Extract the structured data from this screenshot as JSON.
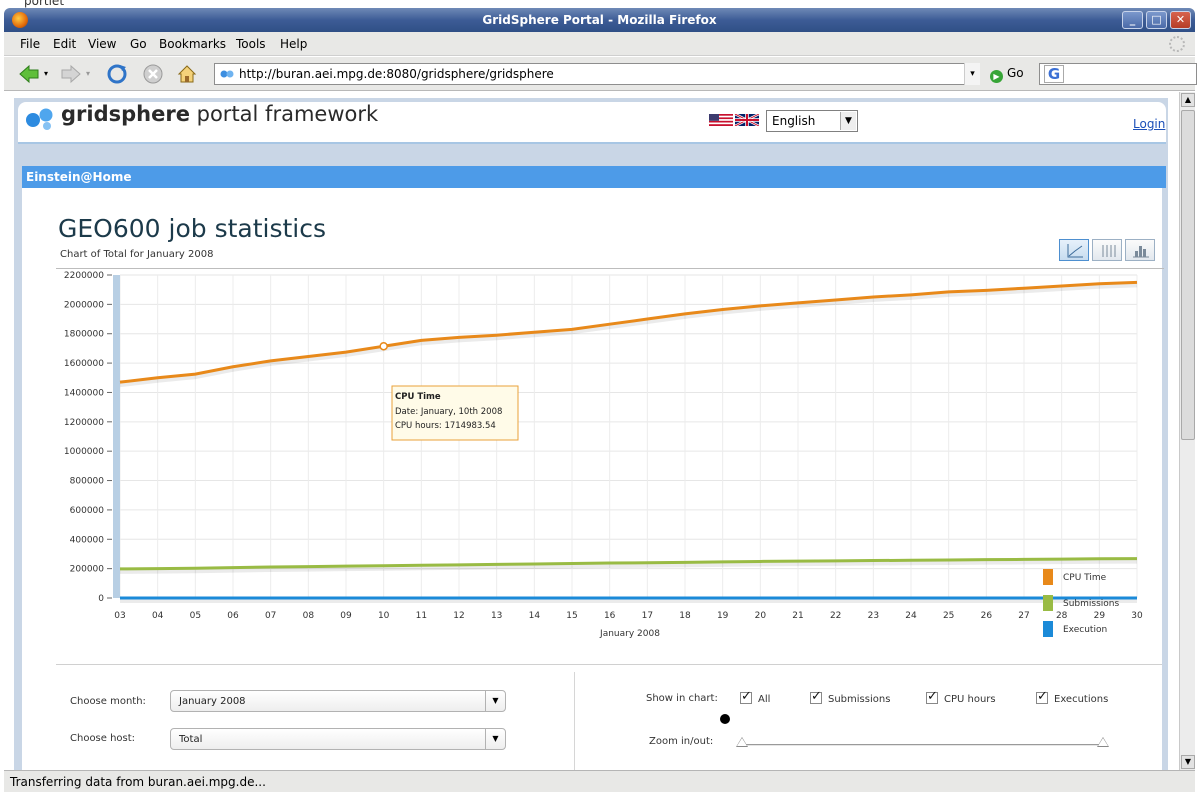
{
  "top_fragment": "portlet",
  "window": {
    "title": "GridSphere Portal - Mozilla Firefox",
    "controls": [
      "minimize",
      "maximize",
      "close"
    ]
  },
  "menubar": {
    "items": [
      {
        "label": "File"
      },
      {
        "label": "Edit"
      },
      {
        "label": "View"
      },
      {
        "label": "Go"
      },
      {
        "label": "Bookmarks"
      },
      {
        "label": "Tools"
      },
      {
        "label": "Help"
      }
    ]
  },
  "navbar": {
    "url": "http://buran.aei.mpg.de:8080/gridsphere/gridsphere",
    "go_label": "Go",
    "search_engine_letter": "G"
  },
  "portal": {
    "logo_bold": "gridsphere",
    "logo_rest": " portal framework",
    "language": "English",
    "login_label": "Login",
    "portlet_title": "Einstein@Home"
  },
  "page": {
    "title": "GEO600 job statistics",
    "subtitle": "Chart of Total for January 2008",
    "view_buttons": [
      "line-chart-icon",
      "table-icon",
      "bar-chart-icon"
    ]
  },
  "chart_data": {
    "type": "line",
    "xlabel": "January 2008",
    "ylabel": "",
    "x": [
      "03",
      "04",
      "05",
      "06",
      "07",
      "08",
      "09",
      "10",
      "11",
      "12",
      "13",
      "14",
      "15",
      "16",
      "17",
      "18",
      "19",
      "20",
      "21",
      "22",
      "23",
      "24",
      "25",
      "26",
      "27",
      "28",
      "29",
      "30"
    ],
    "ylim": [
      0,
      2200000
    ],
    "yticks": [
      "2200000",
      "2000000",
      "1800000",
      "1600000",
      "1400000",
      "1200000",
      "1000000",
      "800000",
      "600000",
      "400000",
      "200000",
      "0"
    ],
    "grid": true,
    "legend_position": "bottom-right",
    "series": [
      {
        "name": "CPU Time",
        "color": "#e8891a",
        "values": [
          1470000,
          1500000,
          1525000,
          1575000,
          1615000,
          1645000,
          1675000,
          1714984,
          1755000,
          1775000,
          1790000,
          1810000,
          1830000,
          1865000,
          1900000,
          1935000,
          1965000,
          1990000,
          2010000,
          2030000,
          2050000,
          2065000,
          2085000,
          2095000,
          2110000,
          2125000,
          2140000,
          2150000
        ]
      },
      {
        "name": "Submissions",
        "color": "#99bb44",
        "values": [
          198000,
          200000,
          203000,
          207000,
          211000,
          214000,
          217000,
          220000,
          223000,
          226000,
          229000,
          232000,
          235000,
          238000,
          240000,
          243000,
          246000,
          249000,
          251000,
          253000,
          255000,
          257000,
          259000,
          261000,
          263000,
          265000,
          267000,
          268000
        ]
      },
      {
        "name": "Execution",
        "color": "#1b8ad8",
        "values": [
          0,
          0,
          0,
          0,
          0,
          0,
          0,
          0,
          0,
          0,
          0,
          0,
          0,
          0,
          0,
          0,
          0,
          0,
          0,
          0,
          0,
          0,
          0,
          0,
          0,
          0,
          0,
          0
        ]
      }
    ],
    "tooltip": {
      "series": "CPU Time",
      "title": "CPU Time",
      "date_line": "Date: January, 10th 2008",
      "value_line": "CPU hours: 1714983.54",
      "x": "10",
      "y": 1714984
    }
  },
  "controls": {
    "choose_month_label": "Choose month:",
    "month_value": "January 2008",
    "choose_host_label": "Choose host:",
    "host_value": "Total",
    "show_in_chart_label": "Show in chart:",
    "checkboxes": [
      {
        "label": "All",
        "checked": true
      },
      {
        "label": "Submissions",
        "checked": true
      },
      {
        "label": "CPU hours",
        "checked": true
      },
      {
        "label": "Executions",
        "checked": true
      }
    ],
    "zoom_label": "Zoom in/out:"
  },
  "status": {
    "text": "Transferring data from buran.aei.mpg.de..."
  }
}
